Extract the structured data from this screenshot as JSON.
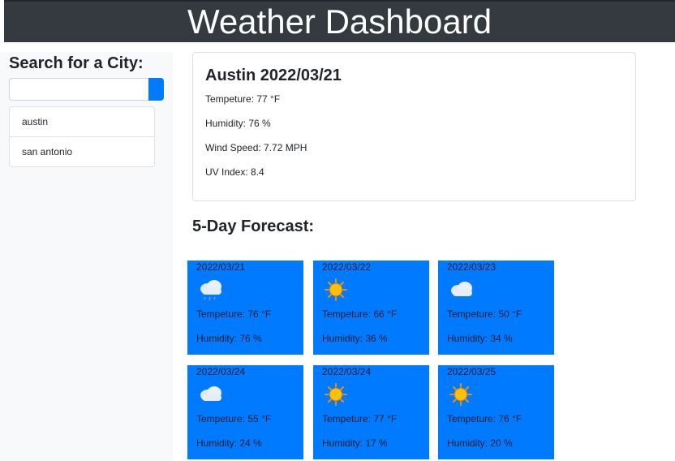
{
  "header": {
    "title": "Weather Dashboard"
  },
  "sidebar": {
    "title": "Search for a City:",
    "search": {
      "value": "",
      "placeholder": ""
    },
    "history": [
      "austin",
      "san antonio"
    ]
  },
  "current": {
    "title": "Austin 2022/03/21",
    "temperature": "Tempeture: 77 °F",
    "humidity": "Humidity: 76 %",
    "wind": "Wind Speed: 7.72 MPH",
    "uv": "UV Index: 8.4"
  },
  "forecast": {
    "heading": "5-Day Forecast:",
    "days": [
      {
        "date": "2022/03/21",
        "icon": "rain-cloud-icon",
        "temp": "Tempeture: 76 °F",
        "humidity": "Humidity: 76 %"
      },
      {
        "date": "2022/03/22",
        "icon": "sun-icon",
        "temp": "Tempeture: 66 °F",
        "humidity": "Humidity: 36 %"
      },
      {
        "date": "2022/03/23",
        "icon": "cloud-icon",
        "temp": "Tempeture: 50 °F",
        "humidity": "Humidity: 34 %"
      },
      {
        "date": "2022/03/24",
        "icon": "cloud-icon",
        "temp": "Tempeture: 55 °F",
        "humidity": "Humidity: 24 %"
      },
      {
        "date": "2022/03/24",
        "icon": "sun-icon",
        "temp": "Tempeture: 77 °F",
        "humidity": "Humidity: 17 %"
      },
      {
        "date": "2022/03/25",
        "icon": "sun-icon",
        "temp": "Tempeture: 76 °F",
        "humidity": "Humidity: 20 %"
      }
    ]
  },
  "colors": {
    "header_bg": "#343a40",
    "accent": "#007bff",
    "sidebar_bg": "#f8f9fa"
  }
}
